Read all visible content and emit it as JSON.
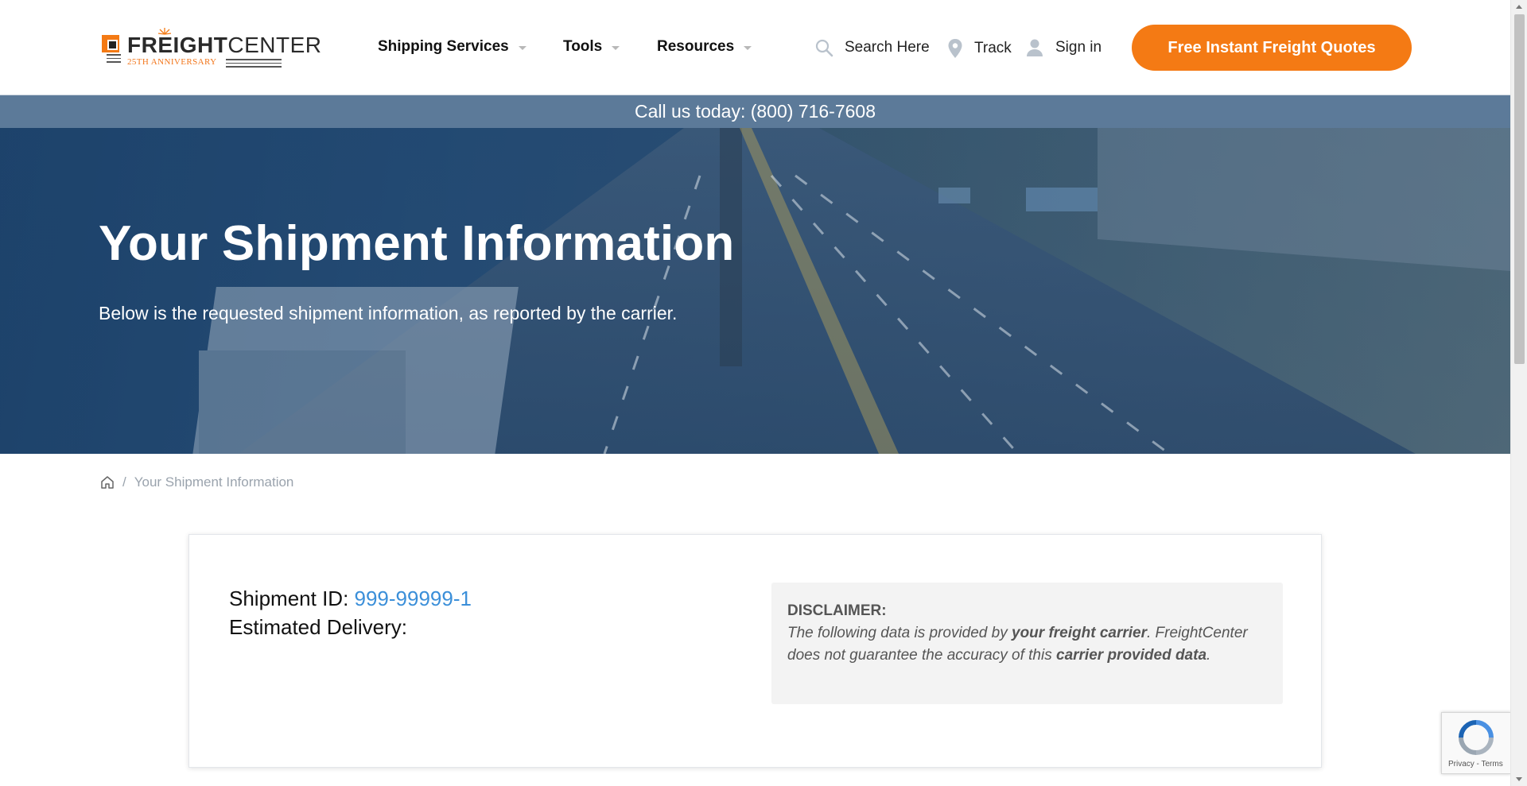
{
  "logo": {
    "brand_bold": "FREIGHT",
    "brand_light": "CENTER",
    "tagline": "25TH ANNIVERSARY"
  },
  "nav": {
    "items": [
      {
        "label": "Shipping Services"
      },
      {
        "label": "Tools"
      },
      {
        "label": "Resources"
      }
    ],
    "search_label": "Search Here",
    "track_label": "Track",
    "signin_label": "Sign in",
    "cta_label": "Free Instant Freight Quotes"
  },
  "callbar": {
    "text": "Call us today: (800) 716-7608"
  },
  "hero": {
    "title": "Your Shipment Information",
    "subtitle": "Below is the requested shipment information, as reported by the carrier."
  },
  "breadcrumb": {
    "current": "Your Shipment Information"
  },
  "shipment": {
    "id_label": "Shipment ID: ",
    "id_value": "999-99999-1",
    "delivery_label": "Estimated Delivery:",
    "delivery_value": ""
  },
  "disclaimer": {
    "heading": "DISCLAIMER:",
    "part1": "The following data is provided by ",
    "bold1": "your freight carrier",
    "part2": ". FreightCenter does not guarantee the accuracy of this ",
    "bold2": "carrier provided data",
    "part3": "."
  },
  "recaptcha": {
    "label": "Privacy - Terms"
  },
  "colors": {
    "accent": "#f47a14",
    "link": "#3b8fd9",
    "callbar": "#5c7a99"
  }
}
